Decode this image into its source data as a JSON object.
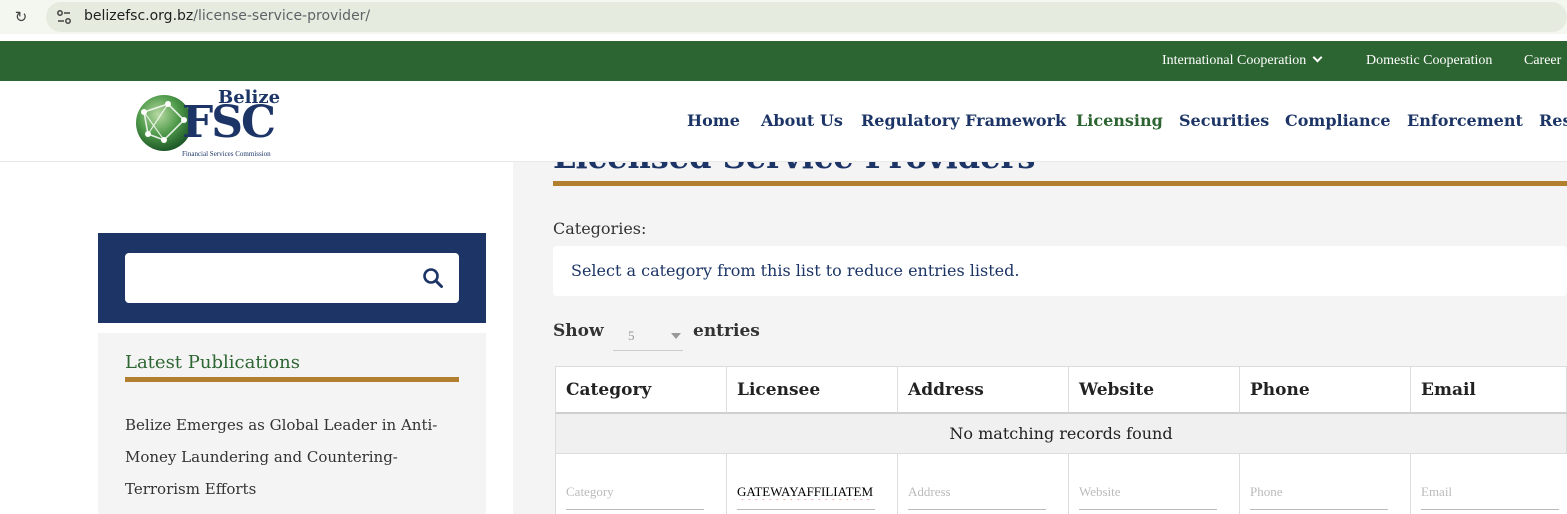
{
  "browser": {
    "url_domain": "belizefsc.org.bz",
    "url_path": "/license-service-provider/"
  },
  "topbar": {
    "items": [
      "International Cooperation",
      "Domestic Cooperation",
      "Career"
    ]
  },
  "logo": {
    "line1": "Belize",
    "line2": "FSC",
    "line3": "Financial Services Commission"
  },
  "nav": {
    "items": [
      "Home",
      "About Us",
      "Regulatory Framework",
      "Licensing",
      "Securities",
      "Compliance",
      "Enforcement",
      "Res"
    ],
    "active": "Licensing"
  },
  "sidebar": {
    "search_placeholder": "",
    "publications_title": "Latest Publications",
    "publication_1": "Belize Emerges as Global Leader in Anti-Money Laundering and Countering-Terrorism Efforts"
  },
  "main": {
    "page_title": "Licensed Service Providers",
    "categories_label": "Categories:",
    "category_select_text": "Select a category from this list to reduce entries listed.",
    "show_label": "Show",
    "entries_value": "5",
    "entries_label": "entries",
    "table": {
      "headers": [
        "Category",
        "Licensee",
        "Address",
        "Website",
        "Phone",
        "Email"
      ],
      "empty_message": "No matching records found",
      "filter_placeholders": [
        "Category",
        "",
        "Address",
        "Website",
        "Phone",
        "Email"
      ],
      "filter_values": [
        "",
        "GATEWAYAFFILIATEM",
        "",
        "",
        "",
        ""
      ]
    }
  },
  "colors": {
    "brand_green": "#2d6532",
    "brand_navy": "#1c3566",
    "accent_gold": "#b17f2d"
  }
}
